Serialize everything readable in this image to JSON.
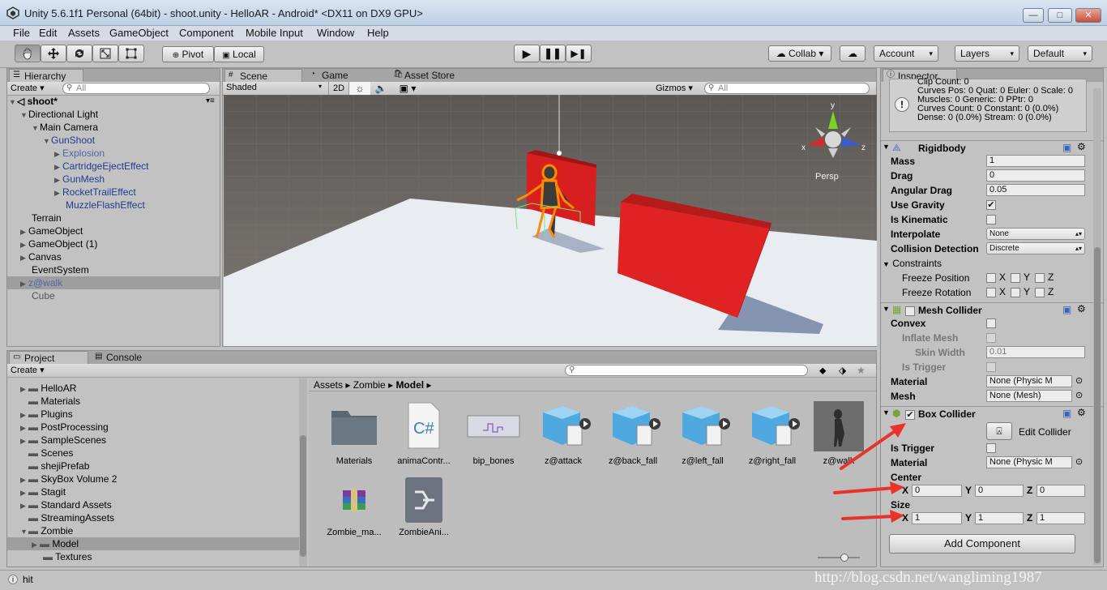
{
  "window": {
    "title": "Unity 5.6.1f1 Personal (64bit) - shoot.unity - HelloAR - Android* <DX11 on DX9 GPU>",
    "min": "—",
    "max": "□",
    "close": "✕"
  },
  "menu": [
    "File",
    "Edit",
    "Assets",
    "GameObject",
    "Component",
    "Mobile Input",
    "Window",
    "Help"
  ],
  "toolbar": {
    "pivot": "Pivot",
    "local": "Local",
    "collab": "Collab ▾",
    "account": "Account",
    "layers": "Layers",
    "layout": "Default"
  },
  "hierarchy": {
    "tab": "Hierarchy",
    "create": "Create ▾",
    "search_placeholder": "All",
    "scene": "shoot*",
    "items": [
      {
        "label": "Directional Light",
        "color": "black"
      },
      {
        "label": "Main Camera",
        "color": "black"
      },
      {
        "label": "GunShoot",
        "color": "blue"
      },
      {
        "label": "Explosion",
        "color": "lblue"
      },
      {
        "label": "CartridgeEjectEffect",
        "color": "blue"
      },
      {
        "label": "GunMesh",
        "color": "blue"
      },
      {
        "label": "RocketTrailEffect",
        "color": "blue"
      },
      {
        "label": "MuzzleFlashEffect",
        "color": "blue"
      },
      {
        "label": "Terrain",
        "color": "black"
      },
      {
        "label": "GameObject",
        "color": "black"
      },
      {
        "label": "GameObject (1)",
        "color": "black"
      },
      {
        "label": "Canvas",
        "color": "black"
      },
      {
        "label": "EventSystem",
        "color": "black"
      },
      {
        "label": "z@walk",
        "color": "lblue"
      },
      {
        "label": "Cube",
        "color": "gray"
      }
    ]
  },
  "scene": {
    "tabs": [
      "Scene",
      "Game",
      "Asset Store"
    ],
    "shading": "Shaded",
    "mode2d": "2D",
    "gizmos": "Gizmos ▾",
    "search_placeholder": "All",
    "persp": "Persp",
    "axes": {
      "y": "y",
      "x": "x",
      "z": "z"
    }
  },
  "project": {
    "tabs": [
      "Project",
      "Console"
    ],
    "create": "Create ▾",
    "folders": [
      "HelloAR",
      "Materials",
      "Plugins",
      "PostProcessing",
      "SampleScenes",
      "Scenes",
      "shejiPrefab",
      "SkyBox Volume 2",
      "Stagit",
      "Standard Assets",
      "StreamingAssets",
      "Zombie",
      "Model",
      "Textures"
    ],
    "breadcrumb": [
      "Assets",
      "Zombie",
      "Model"
    ],
    "assets_row1": [
      "Materials",
      "animaContr...",
      "bip_bones",
      "z@attack",
      "z@back_fall",
      "z@left_fall",
      "z@right_fall",
      "z@walk"
    ],
    "assets_row2": [
      "Zombie_ma...",
      "ZombieAni..."
    ]
  },
  "inspector": {
    "tab": "Inspector",
    "info": [
      "Clip Count: 0",
      "Curves Pos: 0 Quat: 0 Euler: 0 Scale: 0",
      "Muscles: 0 Generic: 0 PPtr: 0",
      "Curves Count: 0 Constant: 0 (0.0%)",
      "Dense: 0 (0.0%) Stream: 0 (0.0%)"
    ],
    "rigidbody": {
      "title": "Rigidbody",
      "mass_label": "Mass",
      "mass": "1",
      "drag_label": "Drag",
      "drag": "0",
      "adrag_label": "Angular Drag",
      "adrag": "0.05",
      "gravity_label": "Use Gravity",
      "kinematic_label": "Is Kinematic",
      "interp_label": "Interpolate",
      "interp": "None",
      "collision_label": "Collision Detection",
      "collision": "Discrete",
      "constraints_label": "Constraints",
      "freeze_pos": "Freeze Position",
      "freeze_rot": "Freeze Rotation"
    },
    "mesh_collider": {
      "title": "Mesh Collider",
      "convex": "Convex",
      "inflate": "Inflate Mesh",
      "skin": "Skin Width",
      "skin_val": "0.01",
      "trigger": "Is Trigger",
      "material_label": "Material",
      "material": "None (Physic M",
      "mesh_label": "Mesh",
      "mesh": "None (Mesh)"
    },
    "box_collider": {
      "title": "Box Collider",
      "edit": "Edit Collider",
      "trigger": "Is Trigger",
      "material_label": "Material",
      "material": "None (Physic M",
      "center_label": "Center",
      "cx": "0",
      "cy": "0",
      "cz": "0",
      "size_label": "Size",
      "sx": "1",
      "sy": "1",
      "sz": "1"
    },
    "add_component": "Add Component"
  },
  "status": {
    "text": "hit",
    "watermark": "http://blog.csdn.net/wangliming1987"
  }
}
